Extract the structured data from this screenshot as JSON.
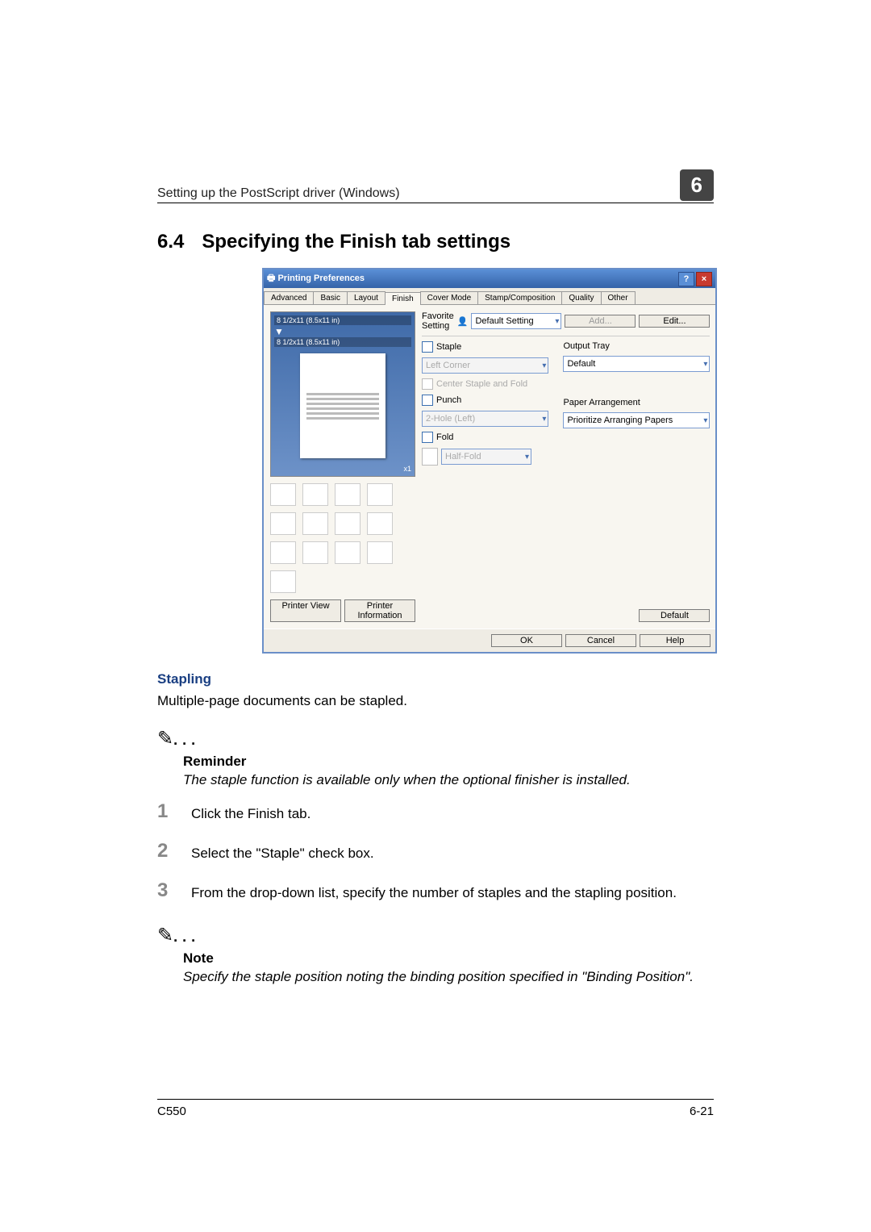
{
  "header": {
    "title": "Setting up the PostScript driver (Windows)",
    "chapter": "6"
  },
  "section": {
    "number": "6.4",
    "title": "Specifying the Finish tab settings"
  },
  "dialog": {
    "windowTitle": "Printing Preferences",
    "tabs": [
      "Advanced",
      "Basic",
      "Layout",
      "Finish",
      "Cover Mode",
      "Stamp/Composition",
      "Quality",
      "Other"
    ],
    "preview": {
      "line1": "8 1/2x11 (8.5x11 in)",
      "line2": "8 1/2x11 (8.5x11 in)",
      "corner": "x1"
    },
    "previewButtons": {
      "view": "Printer View",
      "info": "Printer Information"
    },
    "favorite": {
      "label": "Favorite Setting",
      "value": "Default Setting",
      "addBtn": "Add...",
      "editBtn": "Edit..."
    },
    "staple": {
      "label": "Staple",
      "posValue": "Left Corner",
      "centerLabel": "Center Staple and Fold"
    },
    "punch": {
      "label": "Punch",
      "value": "2-Hole (Left)"
    },
    "fold": {
      "label": "Fold",
      "value": "Half-Fold"
    },
    "output": {
      "label": "Output Tray",
      "value": "Default"
    },
    "arrangement": {
      "label": "Paper Arrangement",
      "value": "Prioritize Arranging Papers"
    },
    "defaultBtn": "Default",
    "okBtn": "OK",
    "cancelBtn": "Cancel",
    "helpBtn": "Help"
  },
  "content": {
    "staplingHead": "Stapling",
    "staplingBody": "Multiple-page documents can be stapled.",
    "reminderHead": "Reminder",
    "reminderBody": "The staple function is available only when the optional finisher is installed.",
    "steps": [
      "Click the Finish tab.",
      "Select the \"Staple\" check box.",
      "From the drop-down list, specify the number of staples and the stapling position."
    ],
    "noteHead": "Note",
    "noteBody": "Specify the staple position noting the binding position specified in \"Binding Position\"."
  },
  "footer": {
    "left": "C550",
    "right": "6-21"
  }
}
